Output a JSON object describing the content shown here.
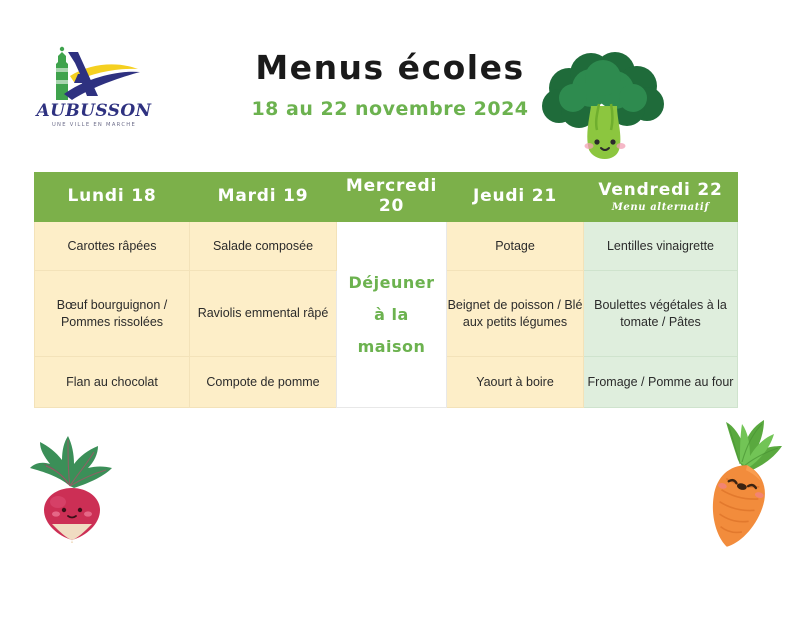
{
  "logo": {
    "city_name": "AUBUSSON",
    "tagline": "UNE VILLE EN MARCHE"
  },
  "header": {
    "title": "Menus écoles",
    "date_range": "18 au 22 novembre 2024"
  },
  "decorations": [
    {
      "name": "broccoli-illustration",
      "position": "top-right"
    },
    {
      "name": "radish-illustration",
      "position": "bottom-left"
    },
    {
      "name": "carrot-illustration",
      "position": "bottom-right"
    }
  ],
  "colors": {
    "header_green": "#7cb04a",
    "subtitle_green": "#6cb24f",
    "cell_cream": "#fdeec8",
    "cell_alt_green": "#dfeedd",
    "logo_navy": "#2e3180",
    "logo_yellow": "#f5d020",
    "logo_green": "#3fa34d"
  },
  "table": {
    "columns": [
      {
        "day": "Lundi 18",
        "note": ""
      },
      {
        "day": "Mardi 19",
        "note": ""
      },
      {
        "day": "Mercredi 20",
        "note": ""
      },
      {
        "day": "Jeudi 21",
        "note": ""
      },
      {
        "day": "Vendredi 22",
        "note": "Menu alternatif"
      }
    ],
    "wednesday_merged": "Déjeuner\nà la\nmaison",
    "wednesday_lines": [
      "Déjeuner",
      "à la",
      "maison"
    ],
    "rows": [
      {
        "course": "entree",
        "lundi": "Carottes râpées",
        "mardi": "Salade composée",
        "jeudi": "Potage",
        "vendredi": "Lentilles vinaigrette"
      },
      {
        "course": "plat",
        "lundi": "Bœuf bourguignon / Pommes rissolées",
        "mardi": "Raviolis emmental râpé",
        "jeudi": "Beignet de poisson / Blé aux petits légumes",
        "vendredi": "Boulettes végétales à la tomate / Pâtes"
      },
      {
        "course": "dessert",
        "lundi": "Flan au chocolat",
        "mardi": "Compote de pomme",
        "jeudi": "Yaourt à boire",
        "vendredi": "Fromage / Pomme au four"
      }
    ]
  }
}
